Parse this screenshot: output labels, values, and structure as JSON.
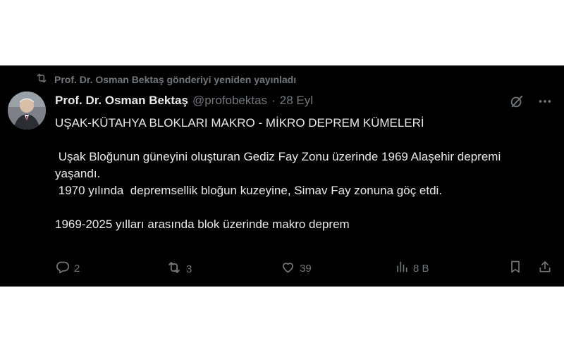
{
  "repost": {
    "text": "Prof. Dr. Osman Bektaş gönderiyi yeniden yayınladı"
  },
  "author": {
    "name": "Prof. Dr. Osman Bektaş",
    "handle": "@profobektas",
    "separator": "·",
    "date": "28 Eyl"
  },
  "post": {
    "lines": [
      "UŞAK-KÜTAHYA BLOKLARI MAKRO - MİKRO DEPREM KÜMELERİ",
      "",
      " Uşak Bloğunun güneyini oluşturan Gediz Fay Zonu üzerinde 1969 Alaşehir depremi yaşandı.",
      " 1970 yılında  depremsellik bloğun kuzeyine, Simav Fay zonuna göç etdi.",
      "",
      "1969-2025 yılları arasında blok üzerinde makro deprem"
    ]
  },
  "stats": {
    "replies": "2",
    "reposts": "3",
    "likes": "39",
    "views": "8 B"
  },
  "icons": {
    "repost_indicator": "repost-icon",
    "grok": "grok-icon",
    "more": "more-icon",
    "reply": "reply-icon",
    "repost": "repost-icon",
    "like": "heart-icon",
    "views": "views-icon",
    "bookmark": "bookmark-icon",
    "share": "share-icon"
  },
  "colors": {
    "background": "#000000",
    "text": "#e7e9ea",
    "muted": "#71767b"
  }
}
